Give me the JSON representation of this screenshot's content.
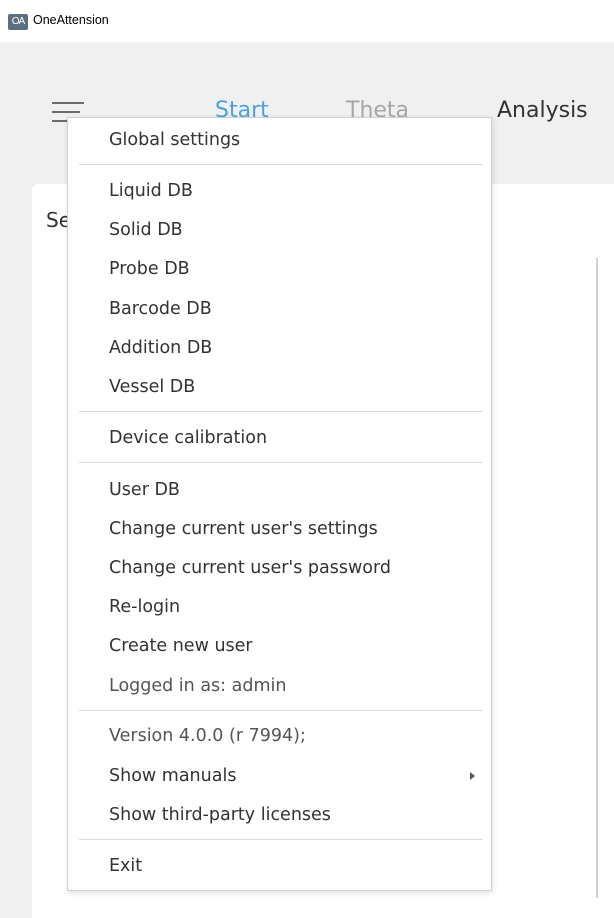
{
  "window": {
    "app_icon_text": "OA",
    "title": "OneAttension"
  },
  "header": {
    "tabs": [
      {
        "label": "Start",
        "active": true
      },
      {
        "label": "Theta",
        "active": false
      },
      {
        "label": "Analysis",
        "active": false
      }
    ]
  },
  "card": {
    "title": "Se"
  },
  "menu": {
    "global_settings": "Global settings",
    "liquid_db": "Liquid DB",
    "solid_db": "Solid DB",
    "probe_db": "Probe DB",
    "barcode_db": "Barcode DB",
    "addition_db": "Addition DB",
    "vessel_db": "Vessel DB",
    "device_calibration": "Device calibration",
    "user_db": "User DB",
    "change_user_settings": "Change current user's settings",
    "change_user_password": "Change current user's password",
    "relogin": "Re-login",
    "create_new_user": "Create new user",
    "logged_in_as": "Logged in as: admin",
    "version": "Version 4.0.0 (r 7994);",
    "show_manuals": "Show manuals",
    "show_licenses": "Show third-party licenses",
    "exit": "Exit"
  },
  "colors": {
    "accent": "#4aa3df",
    "background": "#f0f0f0"
  }
}
